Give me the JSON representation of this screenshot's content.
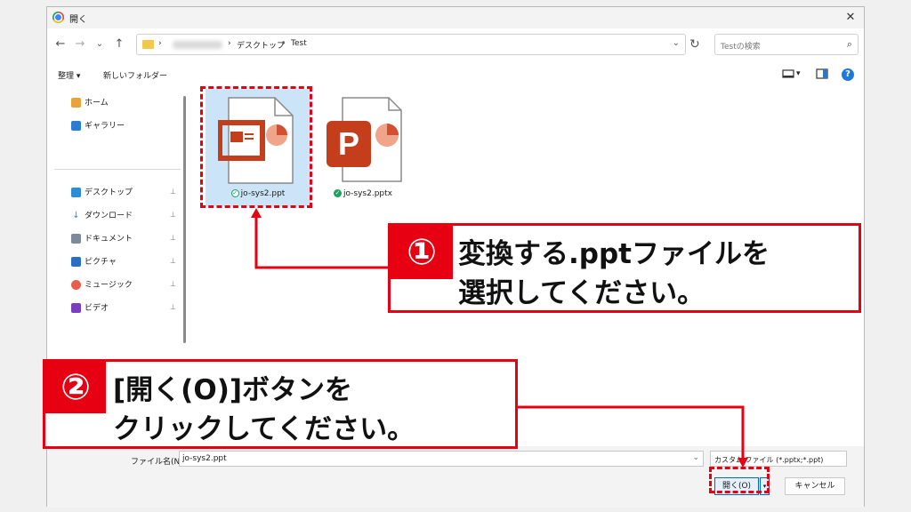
{
  "window": {
    "title": "開く"
  },
  "nav": {
    "back": "←",
    "forward": "→",
    "dropdown": "⌄",
    "up": "↑"
  },
  "address": {
    "crumbs": [
      "›",
      "›",
      "デスクトップ",
      "›",
      "Test"
    ],
    "dropdown": "⌄",
    "refresh": "↻"
  },
  "search": {
    "placeholder": "Testの検索",
    "icon": "⌕"
  },
  "toolbar": {
    "organize": "整理 ▾",
    "new_folder": "新しいフォルダー",
    "view_dropdown": "▾",
    "help": "?"
  },
  "sidebar": {
    "top": [
      {
        "label": "ホーム",
        "icon": "home-icon",
        "color": "#e8a33d"
      },
      {
        "label": "ギャラリー",
        "icon": "gallery-icon",
        "color": "#2b7cd3"
      }
    ],
    "pinned": [
      {
        "label": "デスクトップ",
        "icon": "desktop-icon",
        "color": "#2e8bd8"
      },
      {
        "label": "ダウンロード",
        "icon": "download-icon",
        "color": "#2e8bd8"
      },
      {
        "label": "ドキュメント",
        "icon": "document-icon",
        "color": "#7d8a99"
      },
      {
        "label": "ピクチャ",
        "icon": "pictures-icon",
        "color": "#2b6fc4"
      },
      {
        "label": "ミュージック",
        "icon": "music-icon",
        "color": "#e85d4a"
      },
      {
        "label": "ビデオ",
        "icon": "video-icon",
        "color": "#7a3fbf"
      }
    ],
    "pin_glyph": "📌"
  },
  "files": [
    {
      "name": "jo-sys2.ppt",
      "selected": true,
      "icon": "ppt-legacy-icon"
    },
    {
      "name": "jo-sys2.pptx",
      "selected": false,
      "icon": "pptx-icon"
    }
  ],
  "check": "✓",
  "bottom": {
    "filename_label": "ファイル名(N):",
    "filename_value": "jo-sys2.ppt",
    "filename_dropdown": "⌄",
    "filetype": "カスタム ファイル (*.pptx;*.ppt)",
    "open": "開く(O)",
    "open_dropdown": "▾",
    "cancel": "キャンセル"
  },
  "callouts": [
    {
      "badge": "①",
      "lines": [
        "変換する.pptファイルを",
        "選択してください。"
      ]
    },
    {
      "badge": "②",
      "lines": [
        "[開く(O)]ボタンを",
        "クリックしてください。"
      ]
    }
  ],
  "colors": {
    "annotation_red": "#e60012",
    "selection_blue": "#cce4f7",
    "accent": "#0067c0"
  }
}
